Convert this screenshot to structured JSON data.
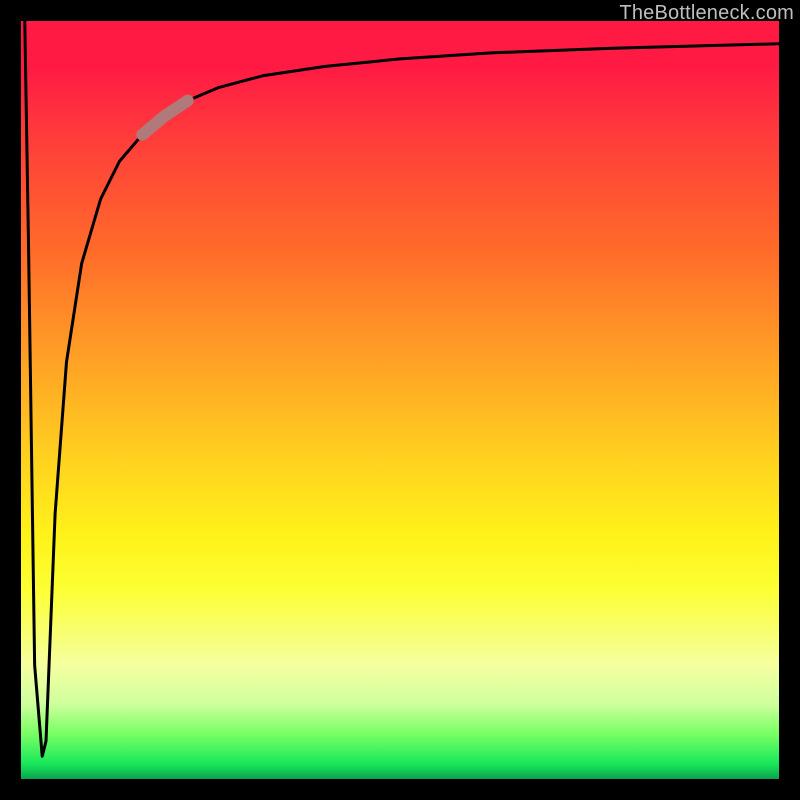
{
  "watermark": "TheBottleneck.com",
  "chart_data": {
    "type": "line",
    "title": "",
    "xlabel": "",
    "ylabel": "",
    "xlim": [
      0,
      100
    ],
    "ylim": [
      0,
      100
    ],
    "x": [
      0.5,
      1.0,
      1.8,
      2.8,
      3.3,
      4.5,
      6.0,
      8.0,
      10.5,
      13.0,
      16.0,
      19.0,
      22.0,
      26.0,
      32.0,
      40.0,
      50.0,
      62.0,
      78.0,
      100.0
    ],
    "values": [
      100.0,
      70.0,
      15.0,
      3.0,
      5.0,
      35.0,
      55.0,
      68.0,
      76.5,
      81.5,
      85.0,
      87.5,
      89.5,
      91.2,
      92.8,
      94.0,
      95.0,
      95.8,
      96.4,
      97.0
    ],
    "highlight_segment": {
      "x_start": 16.0,
      "x_end": 22.0
    }
  }
}
